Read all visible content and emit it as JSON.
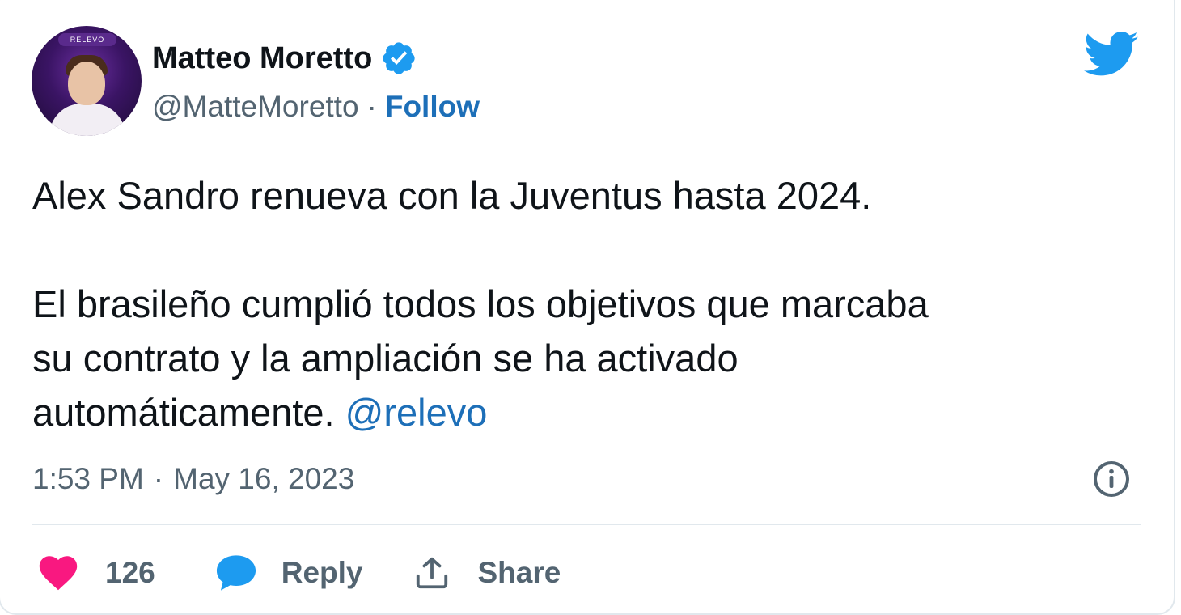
{
  "author": {
    "name": "Matteo Moretto",
    "handle": "@MatteMoretto",
    "separator": "·",
    "follow_label": "Follow",
    "avatar_logo_text": "RELEVO",
    "verified": true
  },
  "tweet": {
    "line1": "Alex Sandro renueva con la Juventus hasta 2024.",
    "line2": "El brasileño cumplió todos los objetivos que marcaba",
    "line3": "su contrato y la ampliación se ha activado",
    "line4_text": "automáticamente. ",
    "mention": "@relevo"
  },
  "meta": {
    "time": "1:53 PM",
    "separator": "·",
    "date": "May 16, 2023"
  },
  "actions": {
    "like_count": "126",
    "reply_label": "Reply",
    "share_label": "Share"
  },
  "icons": {
    "brand": "twitter-bird-icon",
    "verified": "verified-badge-icon",
    "info": "info-icon",
    "like": "heart-icon",
    "reply": "reply-bubble-icon",
    "share": "share-icon"
  },
  "colors": {
    "twitter_blue": "#1d9bf0",
    "link_blue": "#1d6fb8",
    "heart_pink": "#f91880",
    "text_primary": "#0f1419",
    "text_secondary": "#536471",
    "border": "#e1e8ed"
  }
}
